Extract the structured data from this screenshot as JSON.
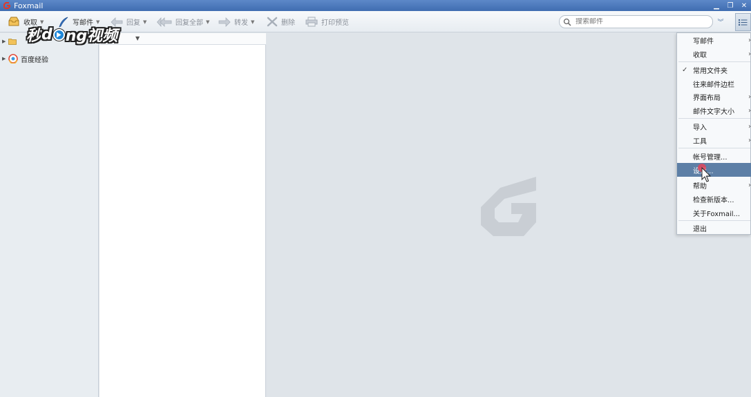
{
  "window": {
    "title": "Foxmail"
  },
  "toolbar": {
    "receive": "收取",
    "compose": "写邮件",
    "reply": "回复",
    "reply_all": "回复全部",
    "forward": "转发",
    "delete": "删除",
    "print_preview": "打印预览"
  },
  "search": {
    "placeholder": "搜索邮件"
  },
  "watermark": {
    "part1": "秒",
    "part2": "d",
    "part3": "ng视频"
  },
  "folders": {
    "account": "百度经验"
  },
  "menu": {
    "items": [
      {
        "label": "写邮件",
        "submenu": true
      },
      {
        "label": "收取",
        "submenu": true
      },
      {
        "label": "常用文件夹",
        "checked": true
      },
      {
        "label": "往来邮件边栏"
      },
      {
        "label": "界面布局",
        "submenu": true
      },
      {
        "label": "邮件文字大小",
        "submenu": true
      },
      {
        "label": "导入",
        "submenu": true
      },
      {
        "label": "工具",
        "submenu": true
      },
      {
        "label": "帐号管理..."
      },
      {
        "label": "设置...",
        "highlighted": true
      },
      {
        "label": "帮助",
        "submenu": true
      },
      {
        "label": "检查新版本..."
      },
      {
        "label": "关于Foxmail..."
      },
      {
        "label": "退出"
      }
    ]
  },
  "icons": {
    "app": "foxmail-logo-icon",
    "receive": "inbox-tray-icon",
    "compose": "quill-pen-icon",
    "reply": "reply-arrow-icon",
    "reply_all": "reply-all-arrow-icon",
    "forward": "forward-arrow-icon",
    "delete": "delete-x-icon",
    "print": "printer-icon",
    "search": "magnifier-icon",
    "menu": "list-menu-icon"
  },
  "colors": {
    "accent": "#5d7fa6",
    "titlebar": "#4a78bd",
    "brand": "#d93a2b"
  }
}
